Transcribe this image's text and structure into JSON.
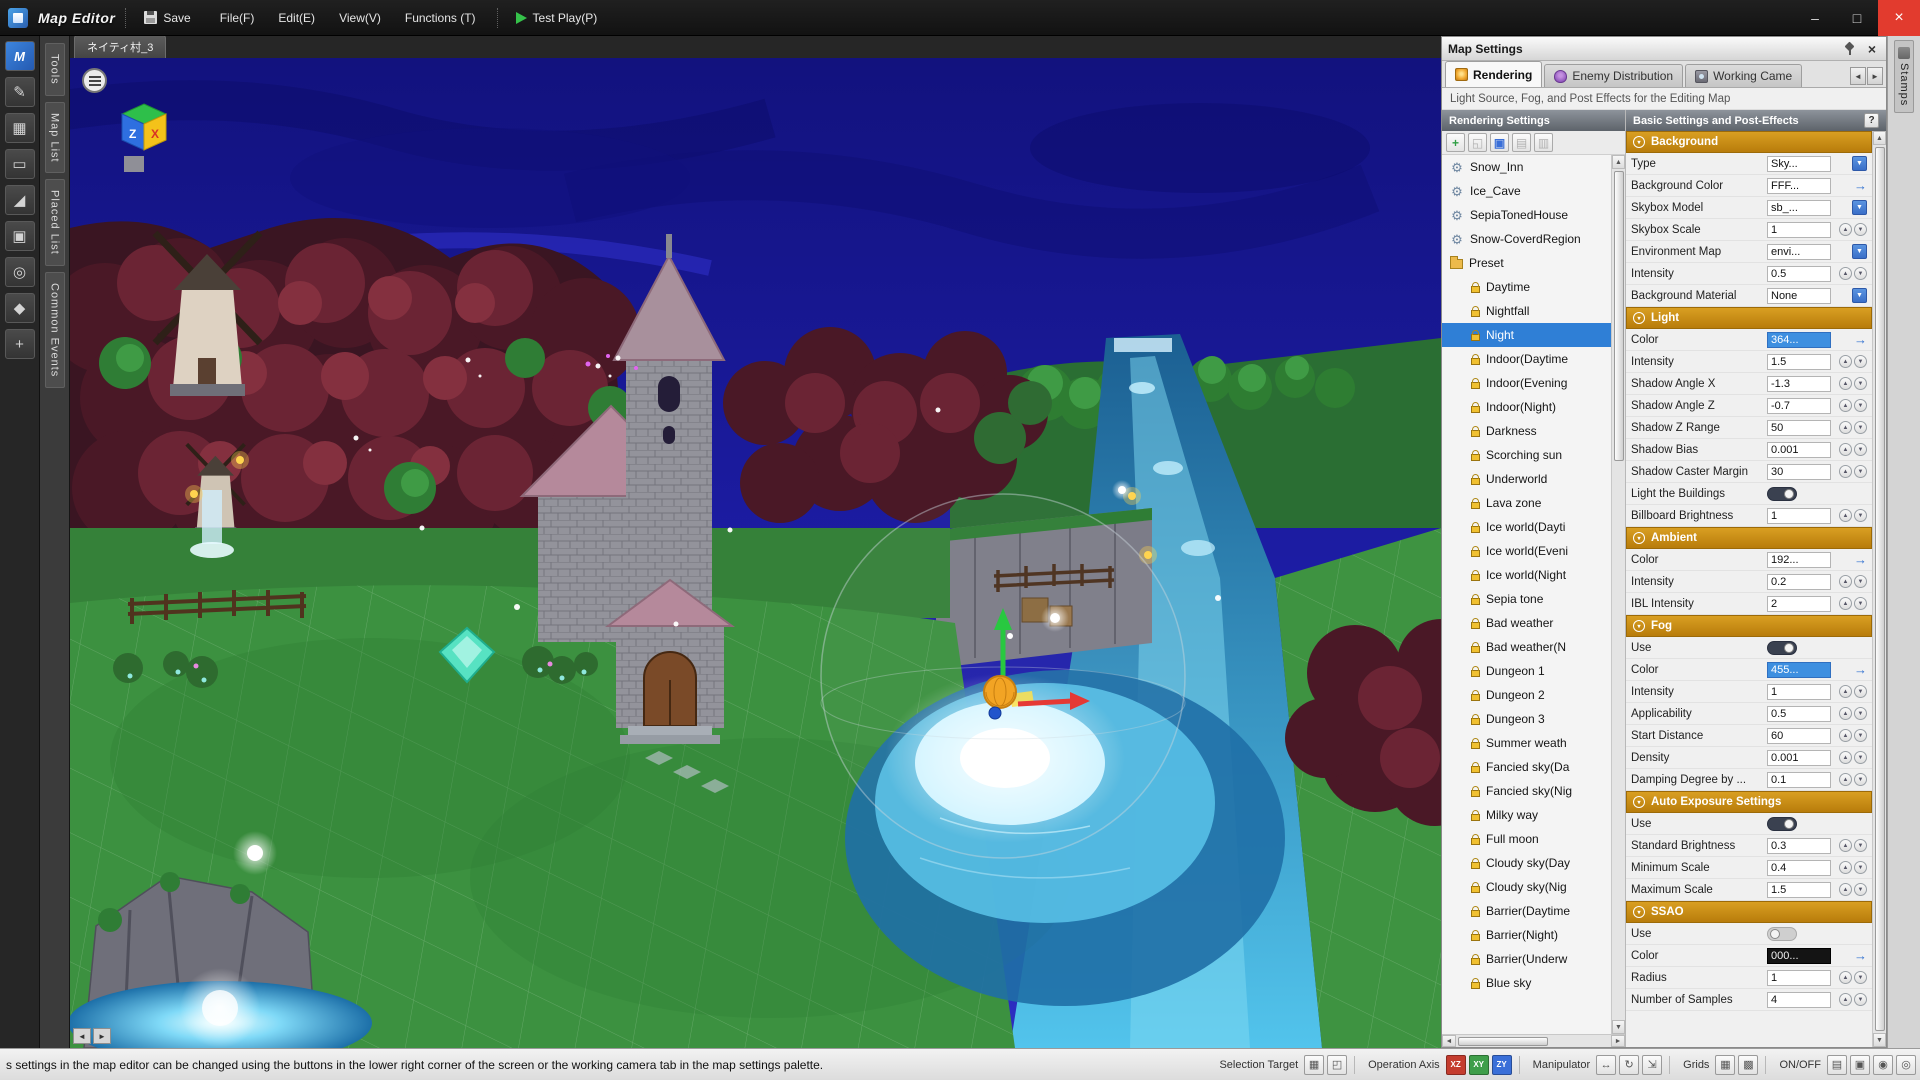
{
  "titlebar": {
    "app_title": "Map Editor",
    "save_label": "Save",
    "menus": [
      "File(F)",
      "Edit(E)",
      "View(V)",
      "Functions (T)"
    ],
    "test_play_label": "Test Play(P)",
    "window_buttons": {
      "minimize": "–",
      "maximize": "□",
      "close": "×"
    }
  },
  "icons": {
    "up": "▲",
    "down": "▼",
    "left": "◄",
    "right": "►",
    "arrow_right": "→",
    "dropdown": "▼",
    "collapse": "▾"
  },
  "left_panel": {
    "side_tabs": [
      "Tools",
      "Map List",
      "Placed List",
      "Common Events"
    ],
    "tools": [
      {
        "name": "edit-pencil-icon",
        "glyph": "✎"
      },
      {
        "name": "terrain-block-icon",
        "glyph": "▦"
      },
      {
        "name": "cylinder-icon",
        "glyph": "▭"
      },
      {
        "name": "slope-icon",
        "glyph": "◢"
      },
      {
        "name": "screen-icon",
        "glyph": "▣"
      },
      {
        "name": "magnifier-icon",
        "glyph": "◎"
      },
      {
        "name": "stamp-icon",
        "glyph": "◆"
      },
      {
        "name": "crosshair-icon",
        "glyph": "+"
      }
    ]
  },
  "viewport": {
    "map_tab": "ネイティ村_3",
    "gizmo_z": "Z",
    "gizmo_x": "X"
  },
  "map_settings": {
    "title": "Map Settings",
    "tabs": [
      {
        "label": "Rendering",
        "icon": "rendering-tab-icon",
        "active": true
      },
      {
        "label": "Enemy Distribution",
        "icon": "enemy-tab-icon",
        "active": false
      },
      {
        "label": "Working Came",
        "icon": "camera-tab-icon",
        "active": false
      }
    ],
    "subtitle": "Light Source, Fog, and Post Effects for the Editing Map",
    "list_header": "Rendering Settings",
    "props_header": "Basic Settings and Post-Effects",
    "help_label": "?",
    "list_toolbar": [
      {
        "name": "add-button",
        "glyph": "+",
        "enabled": true,
        "color": "#2f9e44"
      },
      {
        "name": "import-button",
        "glyph": "◱",
        "enabled": false
      },
      {
        "name": "copy-button",
        "glyph": "▣",
        "enabled": true,
        "color": "#3a6fd8"
      },
      {
        "name": "export-button",
        "glyph": "▤",
        "enabled": false
      },
      {
        "name": "delete-button",
        "glyph": "▥",
        "enabled": false
      }
    ],
    "list": [
      {
        "label": "Snow_Inn",
        "icon": "gear"
      },
      {
        "label": "Ice_Cave",
        "icon": "gear"
      },
      {
        "label": "SepiaTonedHouse",
        "icon": "gear"
      },
      {
        "label": "Snow-CoverdRegion",
        "icon": "gear"
      },
      {
        "label": "Preset",
        "icon": "folder"
      },
      {
        "label": "Daytime",
        "icon": "lock",
        "indent": 1
      },
      {
        "label": "Nightfall",
        "icon": "lock",
        "indent": 1
      },
      {
        "label": "Night",
        "icon": "lock",
        "indent": 1,
        "selected": true
      },
      {
        "label": "Indoor(Daytime",
        "icon": "lock",
        "indent": 1
      },
      {
        "label": "Indoor(Evening",
        "icon": "lock",
        "indent": 1
      },
      {
        "label": "Indoor(Night)",
        "icon": "lock",
        "indent": 1
      },
      {
        "label": "Darkness",
        "icon": "lock",
        "indent": 1
      },
      {
        "label": "Scorching sun",
        "icon": "lock",
        "indent": 1
      },
      {
        "label": "Underworld",
        "icon": "lock",
        "indent": 1
      },
      {
        "label": "Lava zone",
        "icon": "lock",
        "indent": 1
      },
      {
        "label": "Ice world(Dayti",
        "icon": "lock",
        "indent": 1
      },
      {
        "label": "Ice world(Eveni",
        "icon": "lock",
        "indent": 1
      },
      {
        "label": "Ice world(Night",
        "icon": "lock",
        "indent": 1
      },
      {
        "label": "Sepia tone",
        "icon": "lock",
        "indent": 1
      },
      {
        "label": "Bad weather",
        "icon": "lock",
        "indent": 1
      },
      {
        "label": "Bad weather(N",
        "icon": "lock",
        "indent": 1
      },
      {
        "label": "Dungeon 1",
        "icon": "lock",
        "indent": 1
      },
      {
        "label": "Dungeon 2",
        "icon": "lock",
        "indent": 1
      },
      {
        "label": "Dungeon 3",
        "icon": "lock",
        "indent": 1
      },
      {
        "label": "Summer weath",
        "icon": "lock",
        "indent": 1
      },
      {
        "label": "Fancied sky(Da",
        "icon": "lock",
        "indent": 1
      },
      {
        "label": "Fancied sky(Nig",
        "icon": "lock",
        "indent": 1
      },
      {
        "label": "Milky way",
        "icon": "lock",
        "indent": 1
      },
      {
        "label": "Full moon",
        "icon": "lock",
        "indent": 1
      },
      {
        "label": "Cloudy sky(Day",
        "icon": "lock",
        "indent": 1
      },
      {
        "label": "Cloudy sky(Nig",
        "icon": "lock",
        "indent": 1
      },
      {
        "label": "Barrier(Daytime",
        "icon": "lock",
        "indent": 1
      },
      {
        "label": "Barrier(Night)",
        "icon": "lock",
        "indent": 1
      },
      {
        "label": "Barrier(Underw",
        "icon": "lock",
        "indent": 1
      },
      {
        "label": "Blue sky",
        "icon": "lock",
        "indent": 1
      }
    ],
    "sections": [
      {
        "title": "Background",
        "rows": [
          {
            "label": "Type",
            "value": "Sky...",
            "control": "dropdown"
          },
          {
            "label": "Background Color",
            "value": "FFF...",
            "control": "link"
          },
          {
            "label": "Skybox Model",
            "value": "sb_...",
            "control": "dropdown"
          },
          {
            "label": "Skybox Scale",
            "value": "1",
            "control": "stepper"
          },
          {
            "label": "Environment Map",
            "value": "envi...",
            "control": "dropdown"
          },
          {
            "label": "Intensity",
            "value": "0.5",
            "control": "stepper"
          },
          {
            "label": "Background Material",
            "value": "None",
            "control": "dropdown"
          }
        ]
      },
      {
        "title": "Light",
        "rows": [
          {
            "label": "Color",
            "value": "364...",
            "control": "link",
            "highlight": "selected"
          },
          {
            "label": "Intensity",
            "value": "1.5",
            "control": "stepper"
          },
          {
            "label": "Shadow Angle X",
            "value": "-1.3",
            "control": "stepper"
          },
          {
            "label": "Shadow Angle Z",
            "value": "-0.7",
            "control": "stepper"
          },
          {
            "label": "Shadow Z Range",
            "value": "50",
            "control": "stepper"
          },
          {
            "label": "Shadow Bias",
            "value": "0.001",
            "control": "stepper"
          },
          {
            "label": "Shadow Caster Margin",
            "value": "30",
            "control": "stepper"
          },
          {
            "label": "Light the Buildings",
            "control": "toggle",
            "toggle": true
          },
          {
            "label": "Billboard Brightness",
            "value": "1",
            "control": "stepper"
          }
        ]
      },
      {
        "title": "Ambient",
        "rows": [
          {
            "label": "Color",
            "value": "192...",
            "control": "link"
          },
          {
            "label": "Intensity",
            "value": "0.2",
            "control": "stepper"
          },
          {
            "label": "IBL Intensity",
            "value": "2",
            "control": "stepper"
          }
        ]
      },
      {
        "title": "Fog",
        "rows": [
          {
            "label": "Use",
            "control": "toggle",
            "toggle": true
          },
          {
            "label": "Color",
            "value": "455...",
            "control": "link",
            "highlight": "selected"
          },
          {
            "label": "Intensity",
            "value": "1",
            "control": "stepper"
          },
          {
            "label": "Applicability",
            "value": "0.5",
            "control": "stepper"
          },
          {
            "label": "Start Distance",
            "value": "60",
            "control": "stepper"
          },
          {
            "label": "Density",
            "value": "0.001",
            "control": "stepper"
          },
          {
            "label": "Damping Degree by ...",
            "value": "0.1",
            "control": "stepper"
          }
        ]
      },
      {
        "title": "Auto Exposure Settings",
        "rows": [
          {
            "label": "Use",
            "control": "toggle",
            "toggle": true
          },
          {
            "label": "Standard Brightness",
            "value": "0.3",
            "control": "stepper"
          },
          {
            "label": "Minimum Scale",
            "value": "0.4",
            "control": "stepper"
          },
          {
            "label": "Maximum Scale",
            "value": "1.5",
            "control": "stepper"
          }
        ]
      },
      {
        "title": "SSAO",
        "rows": [
          {
            "label": "Use",
            "control": "toggle",
            "toggle": false
          },
          {
            "label": "Color",
            "value": "000...",
            "control": "link",
            "highlight": "dark"
          },
          {
            "label": "Radius",
            "value": "1",
            "control": "stepper"
          },
          {
            "label": "Number of Samples",
            "value": "4",
            "control": "stepper"
          }
        ]
      }
    ]
  },
  "stamps_label": "Stamps",
  "status_bar": {
    "message": "s settings in the map editor can be changed using the buttons in the lower right corner of the screen or the working camera tab in the map settings palette.",
    "selection_target_label": "Selection Target",
    "selection_icons": [
      {
        "name": "grid-target-icon",
        "glyph": "▦"
      },
      {
        "name": "object-target-icon",
        "glyph": "◰"
      }
    ],
    "operation_axis_label": "Operation Axis",
    "axis_chips": [
      {
        "label": "XZ",
        "color": "#c43c2e"
      },
      {
        "label": "XY",
        "color": "#3f9e4a"
      },
      {
        "label": "ZY",
        "color": "#3a6fd8"
      }
    ],
    "manipulator_label": "Manipulator",
    "manipulator_icons": [
      {
        "name": "move-icon",
        "glyph": "↔"
      },
      {
        "name": "rotate-icon",
        "glyph": "↻"
      },
      {
        "name": "scale-icon",
        "glyph": "⇲"
      }
    ],
    "grids_label": "Grids",
    "grid_icons": [
      {
        "name": "grid-icon",
        "glyph": "▦"
      },
      {
        "name": "snap-icon",
        "glyph": "▩"
      }
    ],
    "onoff_label": "ON/OFF",
    "right_icons": [
      {
        "name": "layers-icon",
        "glyph": "▤"
      },
      {
        "name": "display-icon",
        "glyph": "▣"
      },
      {
        "name": "camera-icon",
        "glyph": "◉"
      },
      {
        "name": "settings-icon",
        "glyph": "◎"
      }
    ]
  },
  "colors": {
    "selection_blue": "#2f7fd6",
    "section_orange": "#c8860d",
    "value_highlight": "#3d8fe0"
  }
}
